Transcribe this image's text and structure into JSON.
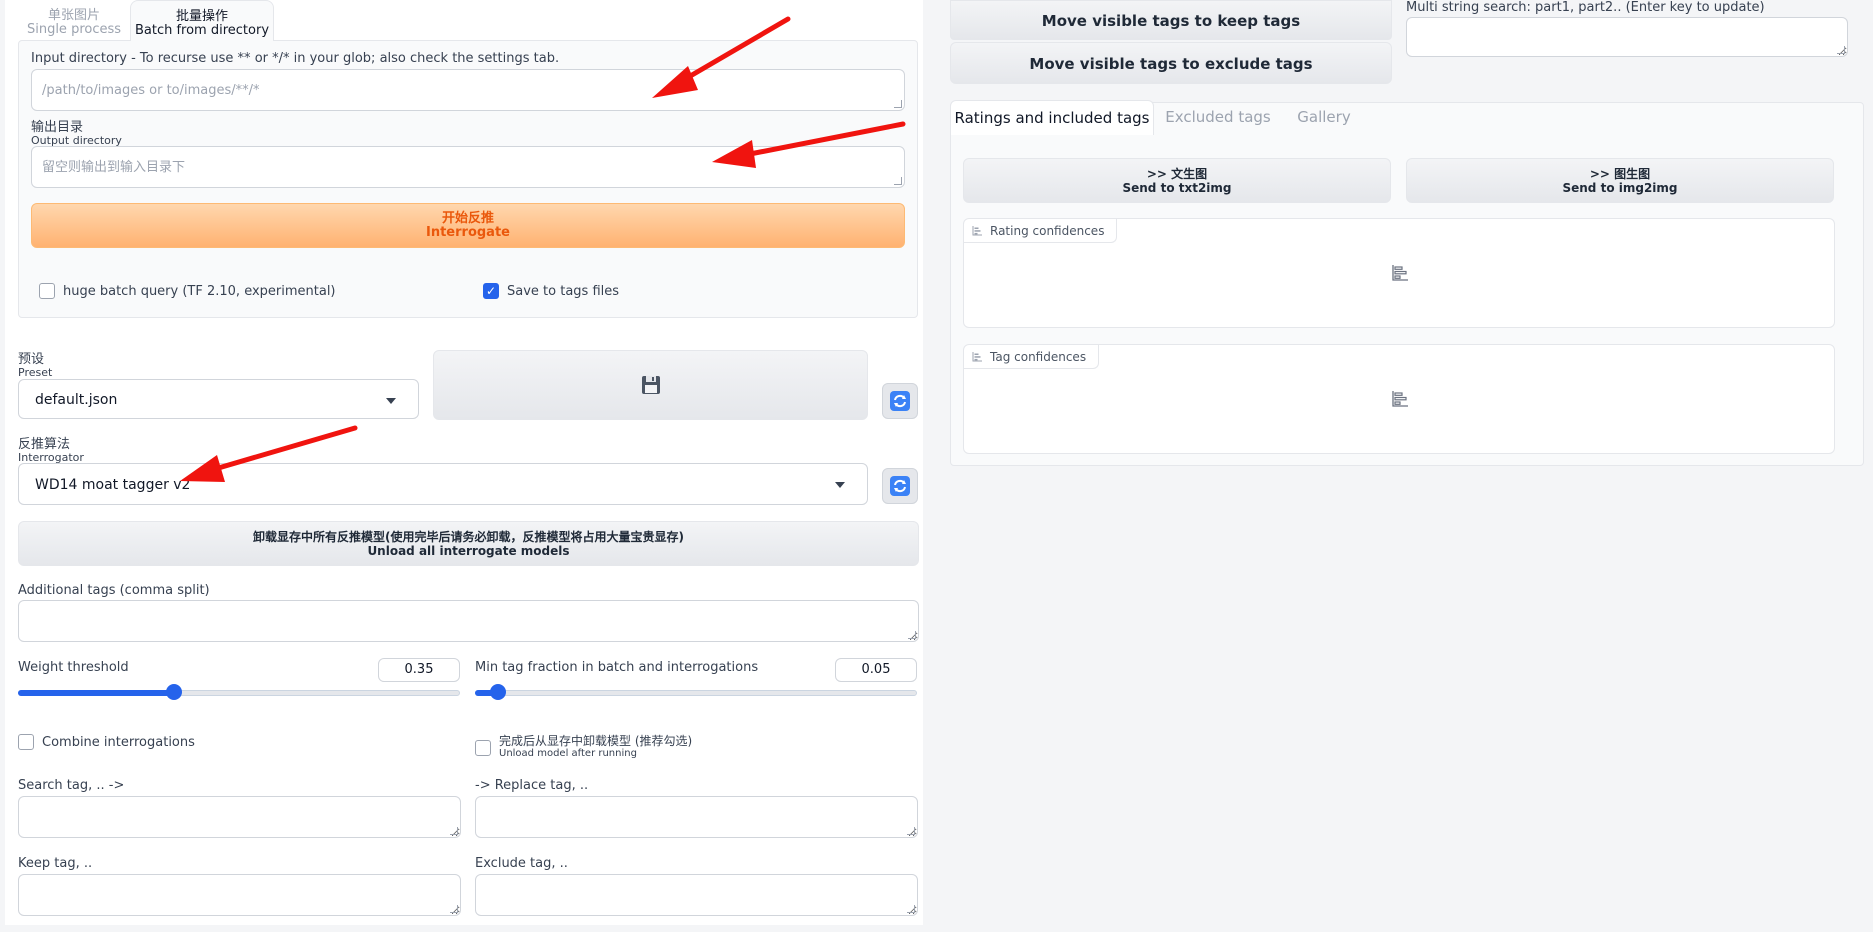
{
  "tabs": {
    "single_zh": "单张图片",
    "single_en": "Single process",
    "batch_zh": "批量操作",
    "batch_en": "Batch from directory"
  },
  "batch": {
    "input_dir_label": "Input directory - To recurse use ** or */* in your glob; also check the settings tab.",
    "input_dir_placeholder": "/path/to/images or to/images/**/*",
    "output_dir_label_zh": "输出目录",
    "output_dir_label_en": "Output directory",
    "output_dir_placeholder": "留空则输出到输入目录下",
    "interrogate_zh": "开始反推",
    "interrogate_en": "Interrogate",
    "huge_batch_label": "huge batch query (TF 2.10, experimental)",
    "huge_batch_checked": false,
    "save_tags_label": "Save to tags files",
    "save_tags_checked": true
  },
  "preset": {
    "label_zh": "预设",
    "label_en": "Preset",
    "value": "default.json",
    "save_icon": "floppy-disk-icon"
  },
  "interrogator": {
    "label_zh": "反推算法",
    "label_en": "Interrogator",
    "value": "WD14 moat tagger v2"
  },
  "unload_all": {
    "zh": "卸载显存中所有反推模型(使用完毕后请务必卸载，反推模型将占用大量宝贵显存)",
    "en": "Unload all interrogate models"
  },
  "additional_tags": {
    "label": "Additional tags (comma split)",
    "value": ""
  },
  "weight_threshold": {
    "label": "Weight threshold",
    "value": "0.35",
    "fraction": 0.35
  },
  "min_tag_fraction": {
    "label": "Min tag fraction in batch and interrogations",
    "value": "0.05",
    "fraction": 0.05
  },
  "combine": {
    "label": "Combine interrogations",
    "checked": false
  },
  "unload_after": {
    "label_zh": "完成后从显存中卸载模型 (推荐勾选)",
    "label_en": "Unload model after running",
    "checked": false
  },
  "search_tag": {
    "label": "Search tag, .. ->"
  },
  "replace_tag": {
    "label": "-> Replace tag, .."
  },
  "keep_tag": {
    "label": "Keep tag, .."
  },
  "exclude_tag": {
    "label": "Exclude tag, .."
  },
  "right": {
    "move_keep": "Move visible tags to keep tags",
    "move_exclude": "Move visible tags to exclude tags",
    "multi_search_label": "Multi string search: part1, part2.. (Enter key to update)",
    "tabs": [
      "Ratings and included tags",
      "Excluded tags",
      "Gallery"
    ],
    "send_txt2img_zh": ">> 文生图",
    "send_txt2img_en": "Send to txt2img",
    "send_img2img_zh": ">> 图生图",
    "send_img2img_en": "Send to img2img",
    "rating_label": "Rating confidences",
    "tag_label": "Tag confidences"
  },
  "colors": {
    "accent": "#2563eb",
    "interrogate_text": "#ea580c",
    "annotation_arrow": "#f0140f"
  }
}
